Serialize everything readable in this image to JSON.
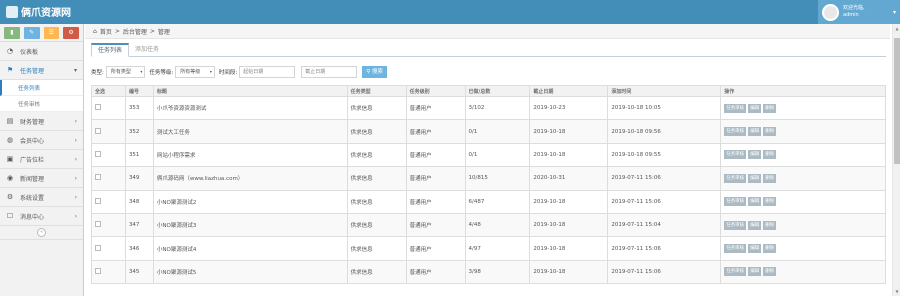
{
  "app": {
    "brand": "俩爪资源网"
  },
  "user": {
    "welcome": "欢迎光临,",
    "name": "admin"
  },
  "shortcuts": [
    {
      "icon": "signal-icon",
      "color": "#87b87f",
      "glyph": "▮"
    },
    {
      "icon": "pencil-icon",
      "color": "#6fb3e0",
      "glyph": "✎"
    },
    {
      "icon": "users-icon",
      "color": "#ffb752",
      "glyph": "☰"
    },
    {
      "icon": "cogs-icon",
      "color": "#d15b47",
      "glyph": "⚙"
    }
  ],
  "sidebar": {
    "items": [
      {
        "label": "仪表板",
        "glyph": "◔",
        "icon": "dashboard-icon"
      },
      {
        "label": "任务管理",
        "glyph": "⚑",
        "icon": "flag-icon",
        "expanded": true
      },
      {
        "label": "财务管理",
        "glyph": "▤",
        "icon": "finance-icon"
      },
      {
        "label": "会员中心",
        "glyph": "◍",
        "icon": "user-icon"
      },
      {
        "label": "广告位栏",
        "glyph": "▣",
        "icon": "ad-icon"
      },
      {
        "label": "新闻管理",
        "glyph": "◉",
        "icon": "news-icon"
      },
      {
        "label": "系统设置",
        "glyph": "⚙",
        "icon": "settings-icon"
      },
      {
        "label": "消息中心",
        "glyph": "☐",
        "icon": "message-icon"
      }
    ],
    "subitems": [
      "任务列表",
      "任务审核"
    ]
  },
  "breadcrumb": {
    "home": "首页",
    "mid": "后台管理",
    "current": "管理"
  },
  "tabs": [
    "任务列表",
    "添加任务"
  ],
  "filters": {
    "type_label": "类型:",
    "type_value": "所有类型",
    "level_label": "任务等级:",
    "level_value": "所有等级",
    "time_label": "时间段:",
    "start_placeholder": "起始日期",
    "end_placeholder": "截止日期",
    "search_label": "搜索"
  },
  "table": {
    "headers": [
      "全选",
      "编号",
      "标题",
      "任务类型",
      "任务级别",
      "已做/总数",
      "截止日期",
      "添加时间",
      "操作"
    ],
    "rows": [
      {
        "id": "353",
        "title": "小爪爷资源资源测试",
        "type": "供求信息",
        "level": "普通用户",
        "progress": "3/102",
        "deadline": "2019-10-23",
        "added": "2019-10-18 10:05"
      },
      {
        "id": "352",
        "title": "测试大工任务",
        "type": "供求信息",
        "level": "普通用户",
        "progress": "0/1",
        "deadline": "2019-10-18",
        "added": "2019-10-18 09:56"
      },
      {
        "id": "351",
        "title": "网站小程序需求",
        "type": "供求信息",
        "level": "普通用户",
        "progress": "0/1",
        "deadline": "2019-10-18",
        "added": "2019-10-18 09:55"
      },
      {
        "id": "349",
        "title": "俩爪源码网（www.liazhua.com）",
        "type": "供求信息",
        "level": "普通用户",
        "progress": "10/815",
        "deadline": "2020-10-31",
        "added": "2019-07-11 15:06"
      },
      {
        "id": "348",
        "title": "小NO聚源测试2",
        "type": "供求信息",
        "level": "普通用户",
        "progress": "6/487",
        "deadline": "2019-10-18",
        "added": "2019-07-11 15:06"
      },
      {
        "id": "347",
        "title": "小NO聚源测试3",
        "type": "供求信息",
        "level": "普通用户",
        "progress": "4/48",
        "deadline": "2019-10-18",
        "added": "2019-07-11 15:04"
      },
      {
        "id": "346",
        "title": "小NO聚源测试4",
        "type": "供求信息",
        "level": "普通用户",
        "progress": "4/97",
        "deadline": "2019-10-18",
        "added": "2019-07-11 15:06"
      },
      {
        "id": "345",
        "title": "小NO聚源测试5",
        "type": "供求信息",
        "level": "普通用户",
        "progress": "3/98",
        "deadline": "2019-10-18",
        "added": "2019-07-11 15:06"
      }
    ],
    "actions": [
      "任务审核",
      "编辑",
      "删除"
    ]
  }
}
